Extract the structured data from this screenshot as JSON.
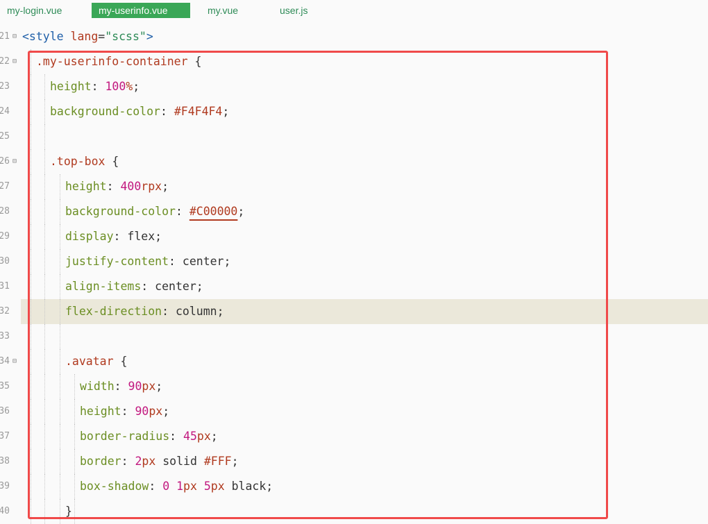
{
  "tabs": [
    {
      "label": "my-login.vue",
      "active": false
    },
    {
      "label": "my-userinfo.vue",
      "active": true
    },
    {
      "label": "my.vue",
      "active": false
    },
    {
      "label": "user.js",
      "active": false
    }
  ],
  "lines": [
    {
      "num": "21",
      "fold": true,
      "segments": [
        [
          "tag",
          "<style"
        ],
        [
          "kw",
          " "
        ],
        [
          "attr",
          "lang"
        ],
        [
          "punc",
          "="
        ],
        [
          "str",
          "\"scss\""
        ],
        [
          "tag",
          ">"
        ]
      ]
    },
    {
      "num": "22",
      "fold": true,
      "segments": [
        [
          "selector",
          ".my-userinfo-container"
        ],
        [
          "punc",
          " {"
        ]
      ]
    },
    {
      "num": "23",
      "fold": false,
      "segments": [
        [
          "prop",
          "height"
        ],
        [
          "punc",
          ": "
        ],
        [
          "num",
          "100"
        ],
        [
          "unit",
          "%"
        ],
        [
          "punc",
          ";"
        ]
      ]
    },
    {
      "num": "24",
      "fold": false,
      "segments": [
        [
          "prop",
          "background-color"
        ],
        [
          "punc",
          ": "
        ],
        [
          "hex",
          "#F4F4F4"
        ],
        [
          "punc",
          ";"
        ]
      ]
    },
    {
      "num": "25",
      "fold": false,
      "segments": []
    },
    {
      "num": "26",
      "fold": true,
      "segments": [
        [
          "selector",
          ".top-box"
        ],
        [
          "punc",
          " {"
        ]
      ]
    },
    {
      "num": "27",
      "fold": false,
      "segments": [
        [
          "prop",
          "height"
        ],
        [
          "punc",
          ": "
        ],
        [
          "num",
          "400"
        ],
        [
          "unit",
          "rpx"
        ],
        [
          "punc",
          ";"
        ]
      ]
    },
    {
      "num": "28",
      "fold": false,
      "segments": [
        [
          "prop",
          "background-color"
        ],
        [
          "punc",
          ": "
        ],
        [
          "hexsq",
          "#C00000"
        ],
        [
          "punc",
          ";"
        ]
      ]
    },
    {
      "num": "29",
      "fold": false,
      "segments": [
        [
          "prop",
          "display"
        ],
        [
          "punc",
          ": "
        ],
        [
          "kw",
          "flex"
        ],
        [
          "punc",
          ";"
        ]
      ]
    },
    {
      "num": "30",
      "fold": false,
      "segments": [
        [
          "prop",
          "justify-content"
        ],
        [
          "punc",
          ": "
        ],
        [
          "kw",
          "center"
        ],
        [
          "punc",
          ";"
        ]
      ]
    },
    {
      "num": "31",
      "fold": false,
      "segments": [
        [
          "prop",
          "align-items"
        ],
        [
          "punc",
          ": "
        ],
        [
          "kw",
          "center"
        ],
        [
          "punc",
          ";"
        ]
      ]
    },
    {
      "num": "32",
      "fold": false,
      "highlight": true,
      "segments": [
        [
          "prop",
          "flex-direction"
        ],
        [
          "punc",
          ": "
        ],
        [
          "kw",
          "column"
        ],
        [
          "punc",
          ";"
        ]
      ]
    },
    {
      "num": "33",
      "fold": false,
      "segments": []
    },
    {
      "num": "34",
      "fold": true,
      "segments": [
        [
          "selector",
          ".avatar"
        ],
        [
          "punc",
          " {"
        ]
      ]
    },
    {
      "num": "35",
      "fold": false,
      "segments": [
        [
          "prop",
          "width"
        ],
        [
          "punc",
          ": "
        ],
        [
          "num",
          "90"
        ],
        [
          "unit",
          "px"
        ],
        [
          "punc",
          ";"
        ]
      ]
    },
    {
      "num": "36",
      "fold": false,
      "segments": [
        [
          "prop",
          "height"
        ],
        [
          "punc",
          ": "
        ],
        [
          "num",
          "90"
        ],
        [
          "unit",
          "px"
        ],
        [
          "punc",
          ";"
        ]
      ]
    },
    {
      "num": "37",
      "fold": false,
      "segments": [
        [
          "prop",
          "border-radius"
        ],
        [
          "punc",
          ": "
        ],
        [
          "num",
          "45"
        ],
        [
          "unit",
          "px"
        ],
        [
          "punc",
          ";"
        ]
      ]
    },
    {
      "num": "38",
      "fold": false,
      "segments": [
        [
          "prop",
          "border"
        ],
        [
          "punc",
          ": "
        ],
        [
          "num",
          "2"
        ],
        [
          "unit",
          "px"
        ],
        [
          "kw",
          " solid "
        ],
        [
          "hex",
          "#FFF"
        ],
        [
          "punc",
          ";"
        ]
      ]
    },
    {
      "num": "39",
      "fold": false,
      "segments": [
        [
          "prop",
          "box-shadow"
        ],
        [
          "punc",
          ": "
        ],
        [
          "num",
          "0"
        ],
        [
          "kw",
          " "
        ],
        [
          "num",
          "1"
        ],
        [
          "unit",
          "px"
        ],
        [
          "kw",
          " "
        ],
        [
          "num",
          "5"
        ],
        [
          "unit",
          "px"
        ],
        [
          "kw",
          " black"
        ],
        [
          "punc",
          ";"
        ]
      ]
    },
    {
      "num": "40",
      "fold": false,
      "segments": [
        [
          "punc",
          "}"
        ]
      ]
    }
  ]
}
